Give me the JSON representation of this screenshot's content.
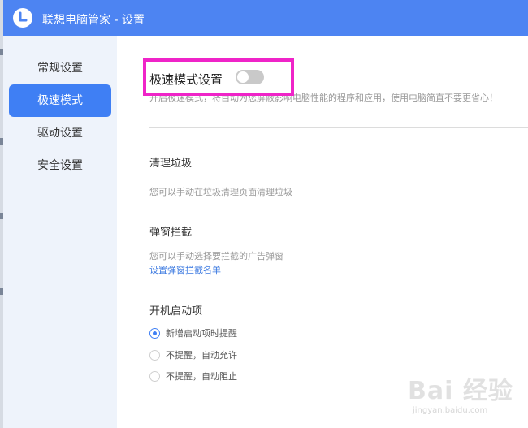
{
  "window": {
    "title": "联想电脑管家 - 设置",
    "app_icon": "lenovo-clock-icon",
    "accent_color": "#4d84f2"
  },
  "sidebar": {
    "items": [
      {
        "label": "常规设置",
        "active": false
      },
      {
        "label": "极速模式",
        "active": true
      },
      {
        "label": "驱动设置",
        "active": false
      },
      {
        "label": "安全设置",
        "active": false
      }
    ],
    "active_color": "#3f7ff4"
  },
  "speed_mode": {
    "title": "极速模式设置",
    "toggle_on": false,
    "description": "开启极速模式，将自动为您屏蔽影响电脑性能的程序和应用，使用电脑简直不要更省心！"
  },
  "cleanup": {
    "title": "清理垃圾",
    "description": "您可以手动在垃圾清理页面清理垃圾"
  },
  "popup_block": {
    "title": "弹窗拦截",
    "description": "您可以手动选择要拦截的广告弹窗",
    "link": "设置弹窗拦截名单"
  },
  "startup": {
    "title": "开机启动项",
    "options": [
      {
        "label": "新增启动项时提醒",
        "checked": true
      },
      {
        "label": "不提醒，自动允许",
        "checked": false
      },
      {
        "label": "不提醒，自动阻止",
        "checked": false
      }
    ]
  },
  "watermark": {
    "text": "Bai 经验",
    "sub": "jingyan.baidu.com"
  }
}
